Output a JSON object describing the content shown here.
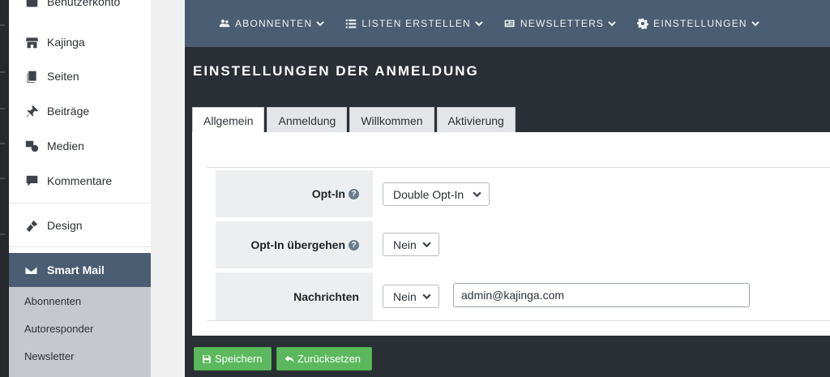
{
  "sidebar": {
    "top_cut_label": "Benutzerkonto",
    "items": [
      {
        "label": "Kajinga",
        "icon": "store-icon"
      },
      {
        "label": "Seiten",
        "icon": "pages-icon"
      },
      {
        "label": "Beiträge",
        "icon": "pin-icon"
      },
      {
        "label": "Medien",
        "icon": "media-icon"
      },
      {
        "label": "Kommentare",
        "icon": "comment-icon"
      },
      {
        "label": "Design",
        "icon": "brush-icon"
      }
    ],
    "active": {
      "label": "Smart Mail",
      "icon": "envelope-icon"
    },
    "sub_items": [
      "Abonnenten",
      "Autoresponder",
      "Newsletter"
    ]
  },
  "topnav": {
    "items": [
      {
        "label": "ABONNENTEN",
        "icon": "users-icon"
      },
      {
        "label": "LISTEN ERSTELLEN",
        "icon": "list-icon"
      },
      {
        "label": "NEWSLETTERS",
        "icon": "newspaper-icon"
      },
      {
        "label": "EINSTELLUNGEN",
        "icon": "gear-icon"
      }
    ]
  },
  "page": {
    "title": "EINSTELLUNGEN DER ANMELDUNG",
    "tabs": [
      "Allgemein",
      "Anmeldung",
      "Willkommen",
      "Aktivierung"
    ],
    "active_tab": "Allgemein"
  },
  "settings": {
    "opt_in": {
      "label": "Opt-In",
      "value": "Double Opt-In"
    },
    "opt_in_skip": {
      "label": "Opt-In übergehen",
      "value": "Nein"
    },
    "messages": {
      "label": "Nachrichten",
      "value": "Nein",
      "email": "admin@kajinga.com"
    }
  },
  "buttons": {
    "save": "Speichern",
    "reset": "Zurücksetzen"
  },
  "colors": {
    "nav_bg": "#4a5d72",
    "button_green": "#5cb85c",
    "panel_dark": "#2a2e35"
  }
}
